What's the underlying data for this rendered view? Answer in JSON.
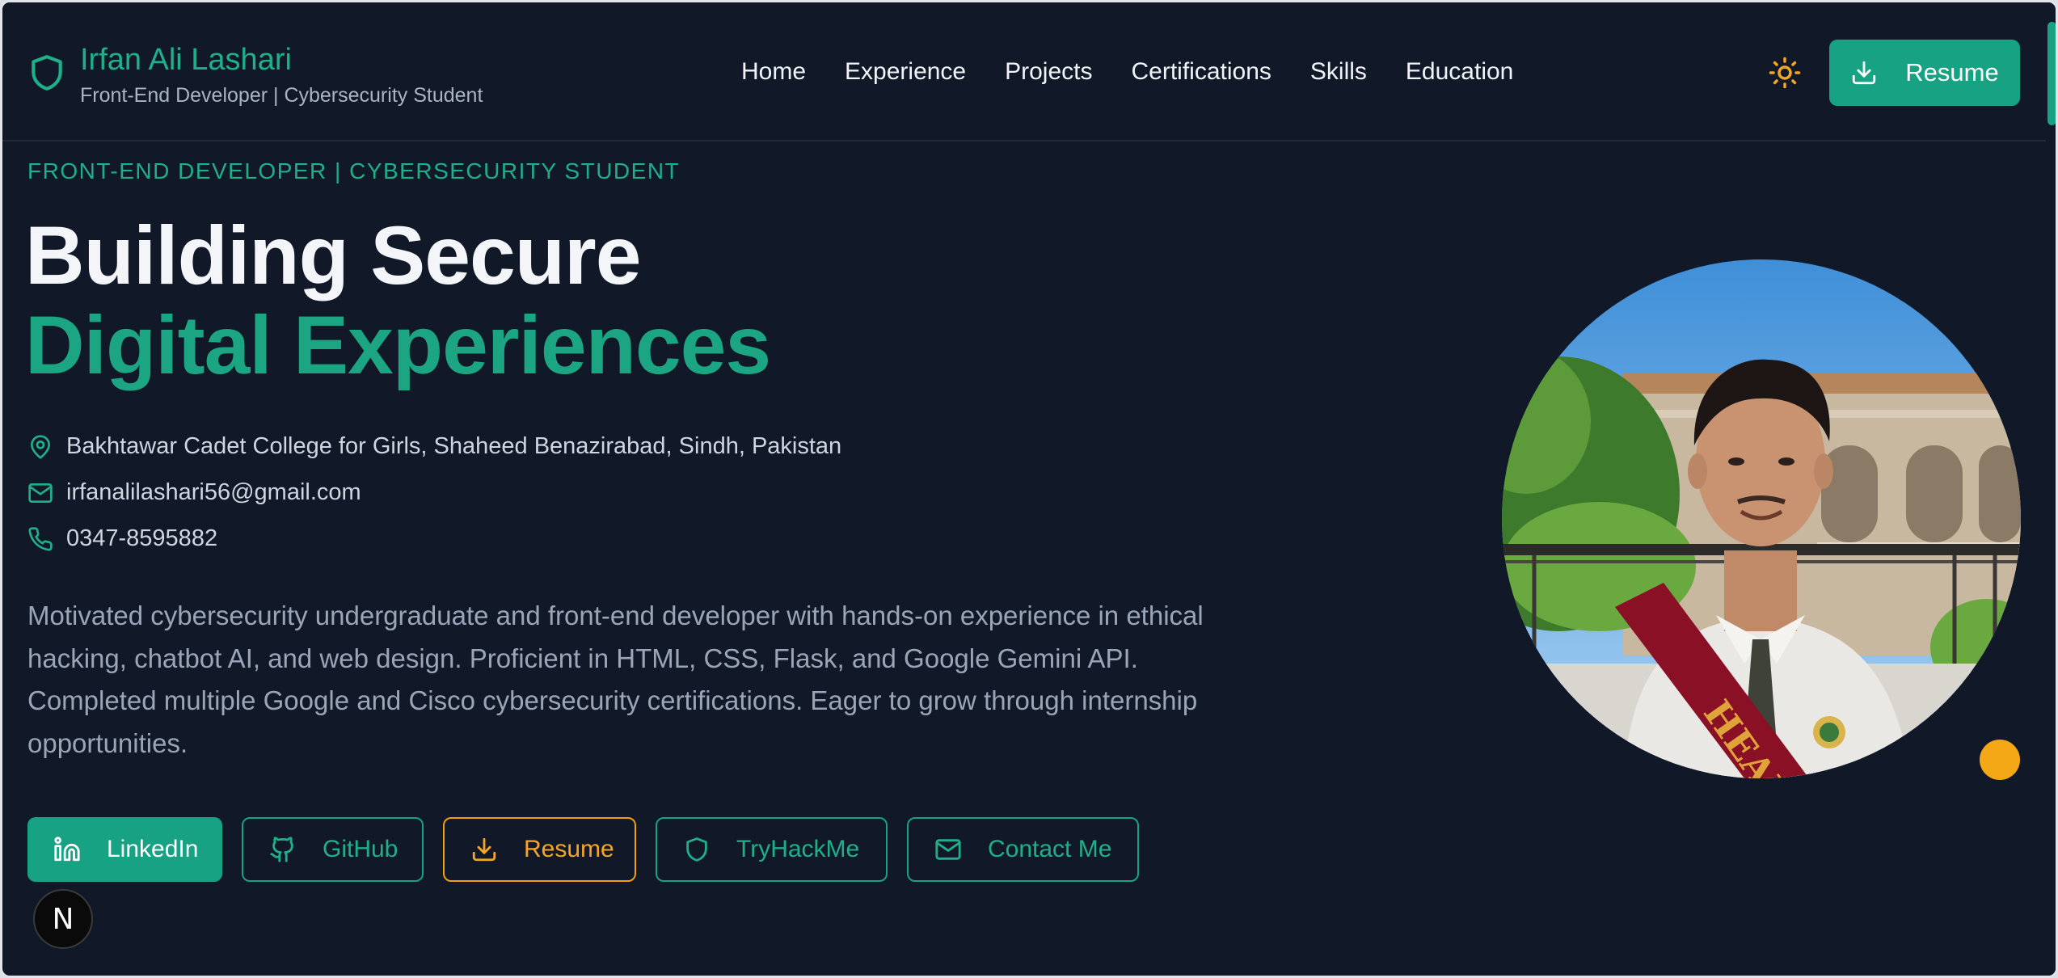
{
  "brand": {
    "name": "Irfan Ali Lashari",
    "tagline": "Front-End Developer | Cybersecurity Student",
    "icon": "shield-icon"
  },
  "nav": {
    "items": [
      {
        "label": "Home"
      },
      {
        "label": "Experience"
      },
      {
        "label": "Projects"
      },
      {
        "label": "Certifications"
      },
      {
        "label": "Skills"
      },
      {
        "label": "Education"
      }
    ],
    "theme_toggle_icon": "sun-icon",
    "resume_button": "Resume"
  },
  "hero": {
    "eyebrow": "FRONT-END DEVELOPER | CYBERSECURITY STUDENT",
    "title_line1": "Building Secure",
    "title_line2": "Digital Experiences",
    "location": "Bakhtawar Cadet College for Girls, Shaheed Benazirabad, Sindh, Pakistan",
    "email": "irfanalilashari56@gmail.com",
    "phone": "0347-8595882",
    "summary": "Motivated cybersecurity undergraduate and front-end developer with hands-on experience in ethical hacking, chatbot AI, and web design. Proficient in HTML, CSS, Flask, and Google Gemini API. Completed multiple Google and Cisco cybersecurity certifications. Eager to grow through internship opportunities.",
    "photo_sash_text": "HEAD"
  },
  "actions": {
    "linkedin": "LinkedIn",
    "github": "GitHub",
    "resume": "Resume",
    "tryhackme": "TryHackMe",
    "contact": "Contact Me"
  },
  "badge": {
    "text": "N"
  },
  "colors": {
    "background": "#111827",
    "accent": "#17a383",
    "accent_text": "#1fb08a",
    "warning": "#f59e0b",
    "heading": "#f3f5f8",
    "muted": "#9aa6b8"
  }
}
